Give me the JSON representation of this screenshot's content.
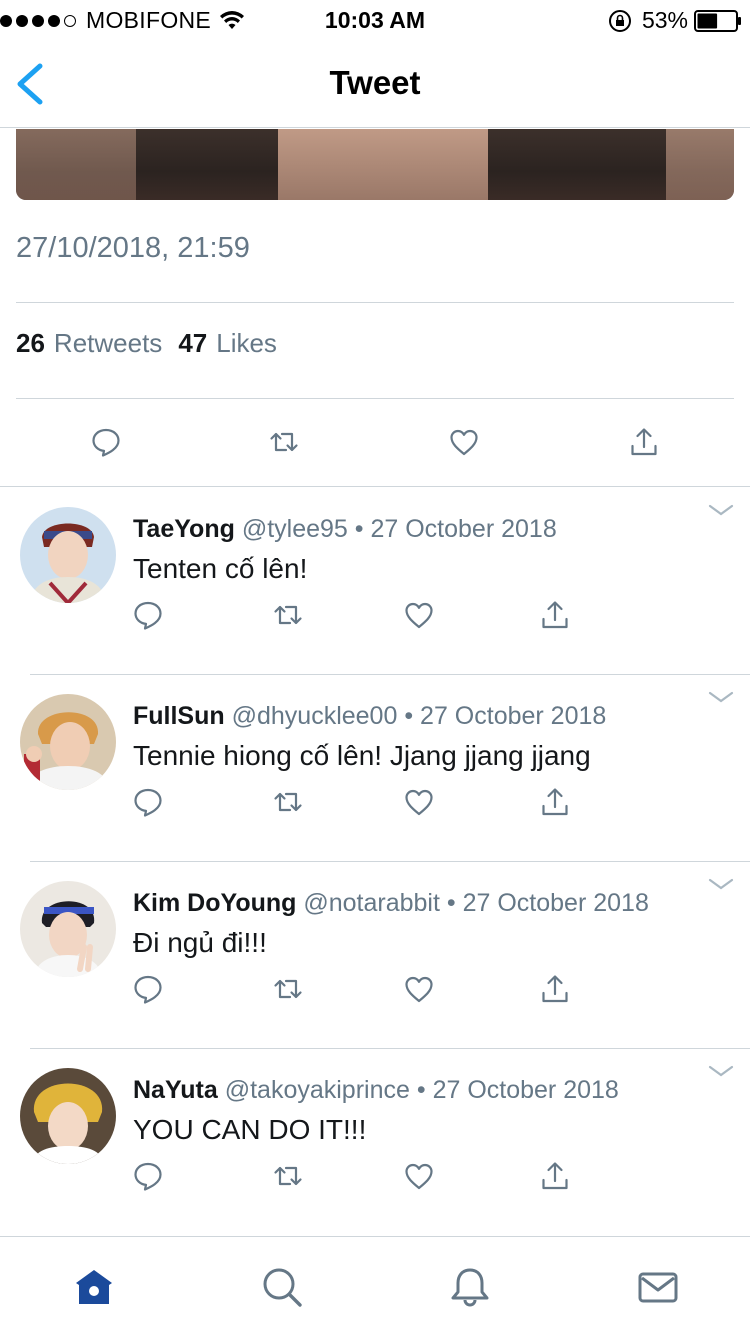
{
  "status_bar": {
    "carrier": "MOBIFONE",
    "time": "10:03 AM",
    "battery": "53%",
    "battery_level": 0.53,
    "signal_bars_filled": 4,
    "signal_bars_total": 5
  },
  "nav": {
    "title": "Tweet"
  },
  "tweet": {
    "timestamp": "27/10/2018, 21:59",
    "retweets_count": "26",
    "retweets_label": "Retweets",
    "likes_count": "47",
    "likes_label": "Likes"
  },
  "replies": [
    {
      "name": "TaeYong",
      "handle": "@tylee95",
      "date": "27 October 2018",
      "text": "Tenten cố lên!"
    },
    {
      "name": "FullSun",
      "handle": "@dhyucklee00",
      "date": "27 October 2018",
      "text": "Tennie hiong cố lên! Jjang jjang jjang"
    },
    {
      "name": "Kim DoYoung",
      "handle": "@notarabbit",
      "date": "27 October 2018",
      "text": "Đi ngủ đi!!!"
    },
    {
      "name": "NaYuta",
      "handle": "@takoyakiprince",
      "date": "27 October 2018",
      "text": "YOU CAN DO IT!!!"
    }
  ],
  "separator": "•",
  "colors": {
    "accent": "#1da1f2",
    "nav_active": "#1b4a9b",
    "icon_gray": "#657786",
    "text": "#14171a",
    "border": "#cfd6db"
  },
  "tabbar": {
    "items": [
      {
        "icon": "home-icon",
        "active": true
      },
      {
        "icon": "search-icon",
        "active": false
      },
      {
        "icon": "bell-icon",
        "active": false
      },
      {
        "icon": "mail-icon",
        "active": false
      }
    ]
  }
}
